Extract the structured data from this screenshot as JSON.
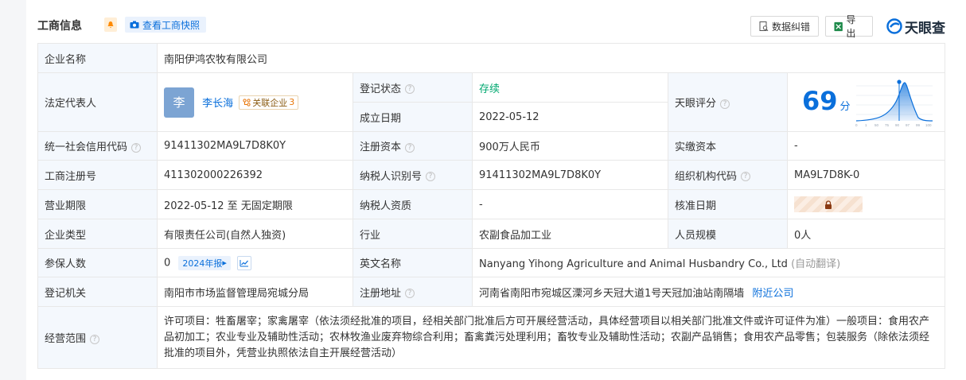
{
  "header": {
    "title": "工商信息",
    "snapshot_label": "查看工商快照",
    "correction_label": "数据纠错",
    "export_label": "导出",
    "brand": "天眼查"
  },
  "colors": {
    "accent": "#0a6fdb",
    "status_green": "#00a870",
    "label_bg": "#f4f8fd",
    "bell": "#ff8a00"
  },
  "icons": [
    "bell-icon",
    "camera-icon",
    "doc-search-icon",
    "excel-icon",
    "brand-logo-icon",
    "help-icon",
    "lock-icon",
    "trend-chart-icon",
    "related-company-icon"
  ],
  "rows": {
    "company_name": {
      "label": "企业名称",
      "value": "南阳伊鸿农牧有限公司"
    },
    "legal_rep": {
      "label": "法定代表人",
      "avatar": "李",
      "name": "李长海",
      "related_label": "关联企业",
      "related_count": "3"
    },
    "reg_status": {
      "label": "登记状态",
      "value": "存续"
    },
    "found_date": {
      "label": "成立日期",
      "value": "2022-05-12"
    },
    "tianyan_score": {
      "label": "天眼评分",
      "score": "69",
      "unit": "分",
      "axis": [
        "0",
        "1",
        "50",
        "75",
        "90",
        "97",
        "99",
        "100"
      ]
    },
    "credit_code": {
      "label": "统一社会信用代码",
      "value": "91411302MA9L7D8K0Y"
    },
    "reg_capital": {
      "label": "注册资本",
      "value": "900万人民币"
    },
    "paid_capital": {
      "label": "实缴资本",
      "value": "-"
    },
    "biz_reg_no": {
      "label": "工商注册号",
      "value": "411302000226392"
    },
    "taxpayer_id": {
      "label": "纳税人识别号",
      "value": "91411302MA9L7D8K0Y"
    },
    "org_code": {
      "label": "组织机构代码",
      "value": "MA9L7D8K-0"
    },
    "biz_term": {
      "label": "营业期限",
      "value": "2022-05-12 至 无固定期限"
    },
    "taxpayer_qual": {
      "label": "纳税人资质",
      "value": "-"
    },
    "approval_date": {
      "label": "核准日期"
    },
    "company_type": {
      "label": "企业类型",
      "value": "有限责任公司(自然人独资)"
    },
    "industry": {
      "label": "行业",
      "value": "农副食品加工业"
    },
    "staff_size": {
      "label": "人员规模",
      "value": "0人"
    },
    "insured": {
      "label": "参保人数",
      "value": "0",
      "year_btn": "2024年报"
    },
    "english_name": {
      "label": "英文名称",
      "value": "Nanyang Yihong Agriculture and Animal Husbandry Co., Ltd",
      "note": "(自动翻译)"
    },
    "reg_authority": {
      "label": "登记机关",
      "value": "南阳市市场监督管理局宛城分局"
    },
    "reg_address": {
      "label": "注册地址",
      "value": "河南省南阳市宛城区溧河乡天冠大道1号天冠加油站南隔墙",
      "nearby": "附近公司"
    },
    "biz_scope": {
      "label": "经营范围",
      "value": "许可项目：牲畜屠宰；家禽屠宰（依法须经批准的项目，经相关部门批准后方可开展经营活动，具体经营项目以相关部门批准文件或许可证件为准）一般项目：食用农产品初加工；农业专业及辅助性活动；农林牧渔业废弃物综合利用；畜禽粪污处理利用；畜牧专业及辅助性活动；农副产品销售；食用农产品零售；包装服务（除依法须经批准的项目外，凭营业执照依法自主开展经营活动）"
    }
  }
}
